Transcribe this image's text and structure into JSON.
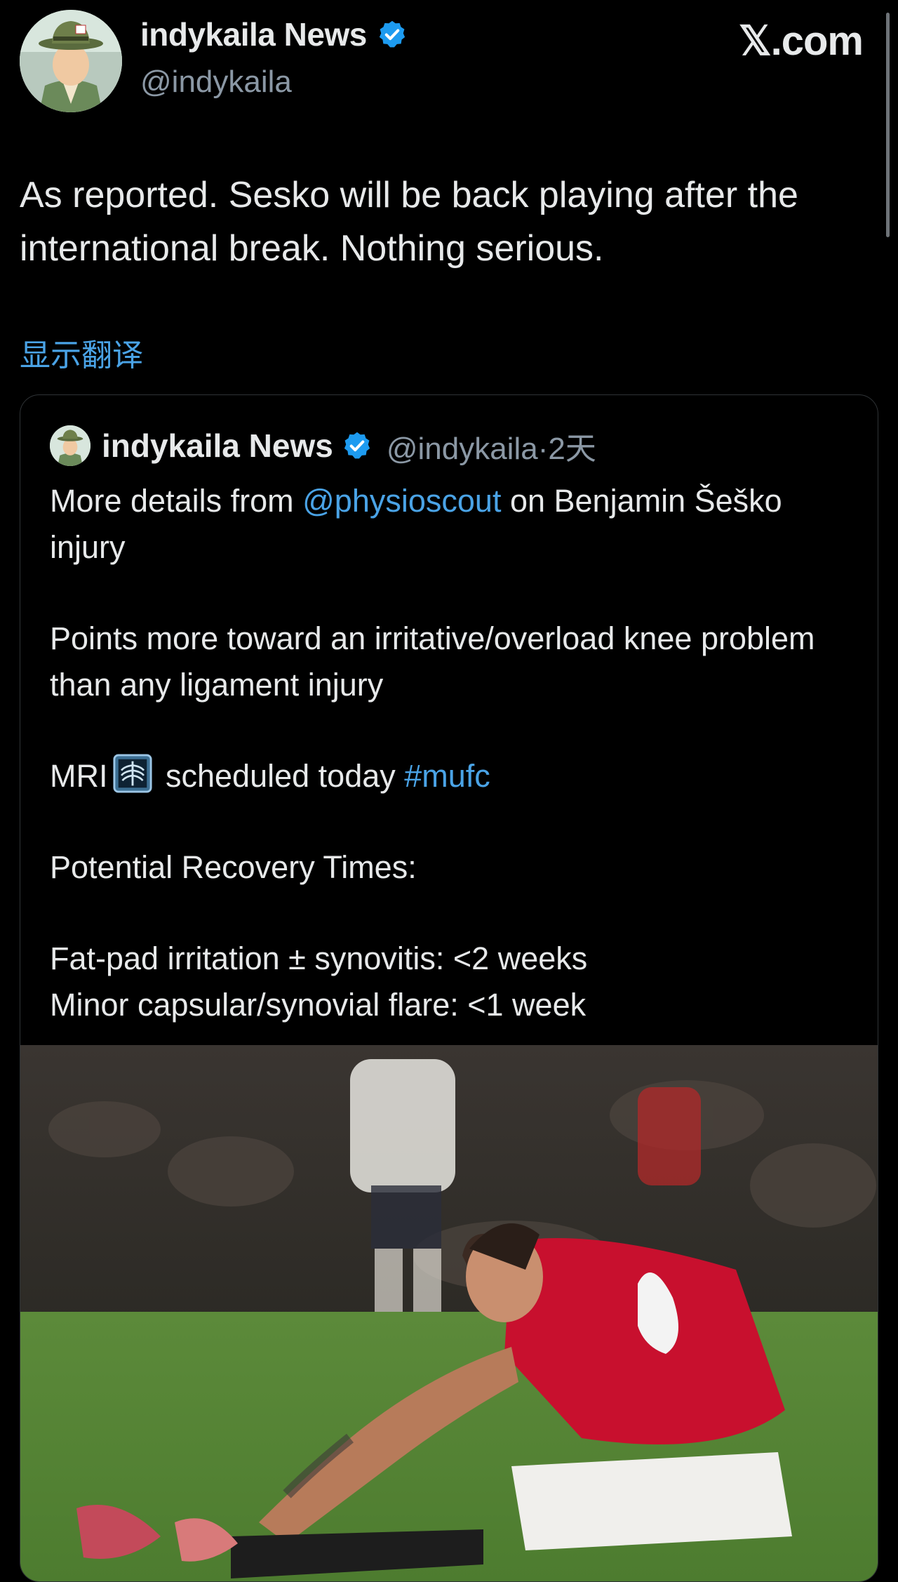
{
  "post": {
    "display_name": "indykaila News",
    "handle": "@indykaila",
    "site_logo": "𝕏.com",
    "text": "As reported. Sesko will be back playing after the international break. Nothing serious.",
    "translate_link": "显示翻译"
  },
  "quoted": {
    "display_name": "indykaila News",
    "handle": "@indykaila",
    "separator": "·",
    "age": "2天",
    "line1_before": "More details from ",
    "line1_mention": "@physioscout",
    "line1_after": " on Benjamin Šeško injury",
    "line2": "Points more toward an irritative/overload knee problem than any ligament injury",
    "line3_before": "MRI",
    "line3_after": " scheduled today ",
    "line3_hashtag": "#mufc",
    "line4": "Potential Recovery Times:",
    "line5": "Fat-pad irritation ± synovitis: <2 weeks",
    "line6": "Minor capsular/synovial flare: <1 week"
  },
  "icons": {
    "verified": "verified-badge-icon",
    "xray": "x-ray-emoji-icon",
    "logo": "x-logo"
  },
  "colors": {
    "background": "#000000",
    "text": "#e7e9ea",
    "secondary_text": "#8b98a5",
    "link": "#4aa3e6",
    "verified": "#1d9bf0",
    "kit_red": "#c8102e"
  }
}
